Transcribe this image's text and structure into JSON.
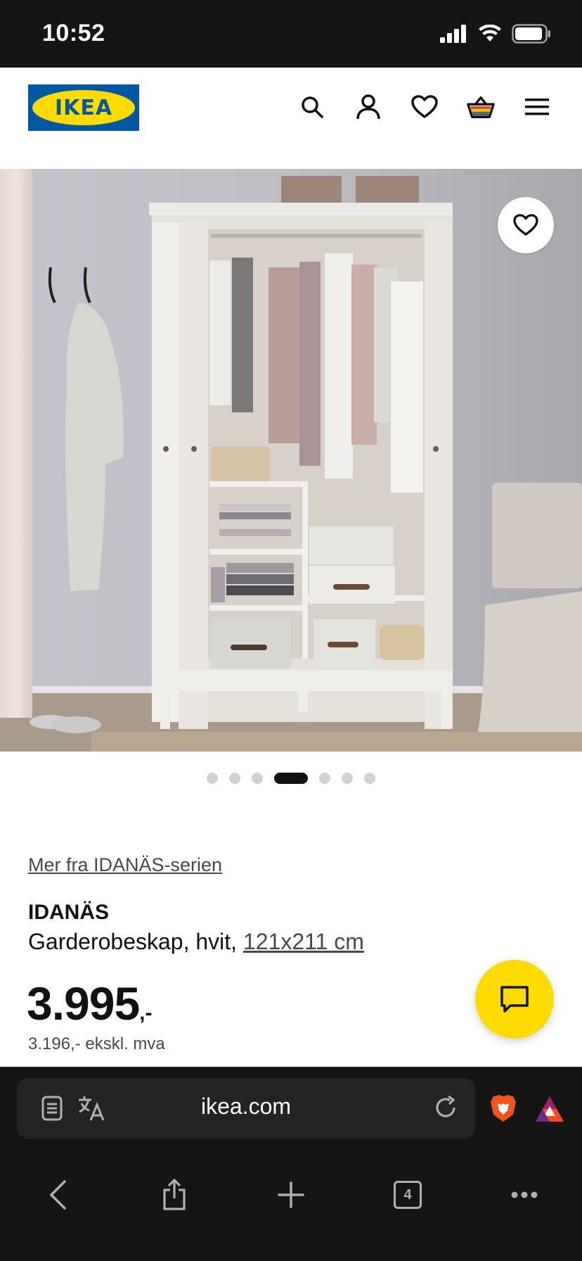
{
  "status_bar": {
    "time": "10:52"
  },
  "header": {
    "logo_text": "IKEA",
    "icons": [
      "search-icon",
      "account-icon",
      "heart-icon",
      "basket-icon",
      "menu-icon"
    ]
  },
  "hero": {
    "carousel_total": 7,
    "carousel_active_index": 3
  },
  "product": {
    "series_link": "Mer fra IDANÄS-serien",
    "name": "IDANÄS",
    "description": "Garderobeskap, hvit, ",
    "dimensions": "121x211 cm",
    "price_main": "3.995",
    "price_suffix": ",-",
    "price_excl_vat": "3.196,- ekskl. mva"
  },
  "browser": {
    "url": "ikea.com",
    "tab_count": "4"
  },
  "colors": {
    "ikea_blue": "#0058a3",
    "ikea_yellow": "#ffdb00",
    "browser_bg": "#151515"
  }
}
